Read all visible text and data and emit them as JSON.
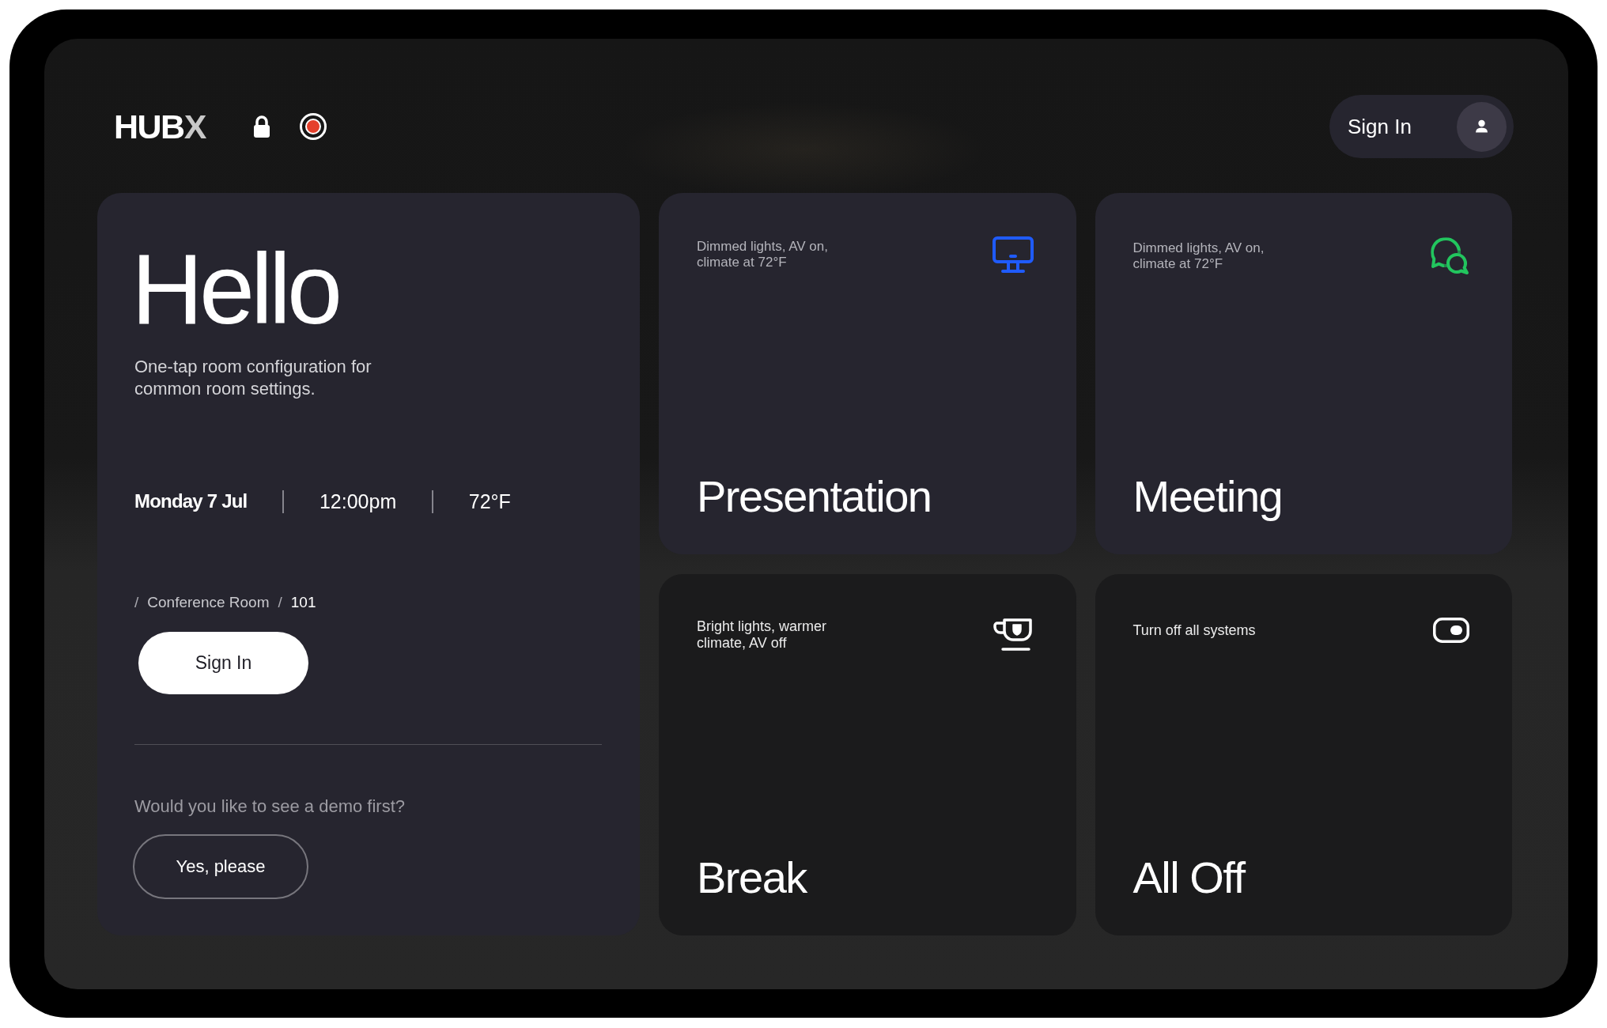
{
  "header": {
    "logo": {
      "text": "HUB",
      "accent": "X"
    },
    "sign_in_button": {
      "label": "Sign In"
    }
  },
  "welcome": {
    "title": "Hello",
    "subtitle": "One-tap room configuration for common room settings.",
    "date": "Monday 7 Jul",
    "time": "12:00pm",
    "temperature": "72°F",
    "breadcrumb": [
      {
        "separator": "/",
        "label": "Conference Room",
        "current": false
      },
      {
        "separator": "/",
        "label": "101",
        "current": true
      }
    ],
    "sign_in_button": {
      "label": "Sign In"
    },
    "demo_prompt": "Would you like to see a demo first?",
    "demo_button": {
      "label": "Yes, please"
    }
  },
  "scenes": [
    {
      "kind": "monitor",
      "highlighted": true,
      "color": "#1f5bff",
      "description": "Dimmed lights, AV on, climate at 72°F",
      "title": "Presentation"
    },
    {
      "kind": "chat",
      "highlighted": true,
      "color": "#22c55e",
      "description": "Dimmed lights, AV on, climate at 72°F",
      "title": "Meeting"
    },
    {
      "kind": "cup",
      "highlighted": false,
      "color": "#ffffff",
      "description": "Bright lights, warmer climate, AV off",
      "title": "Break"
    },
    {
      "kind": "toggle",
      "highlighted": false,
      "color": "#ffffff",
      "description": "Turn off all systems",
      "title": "All Off"
    }
  ]
}
